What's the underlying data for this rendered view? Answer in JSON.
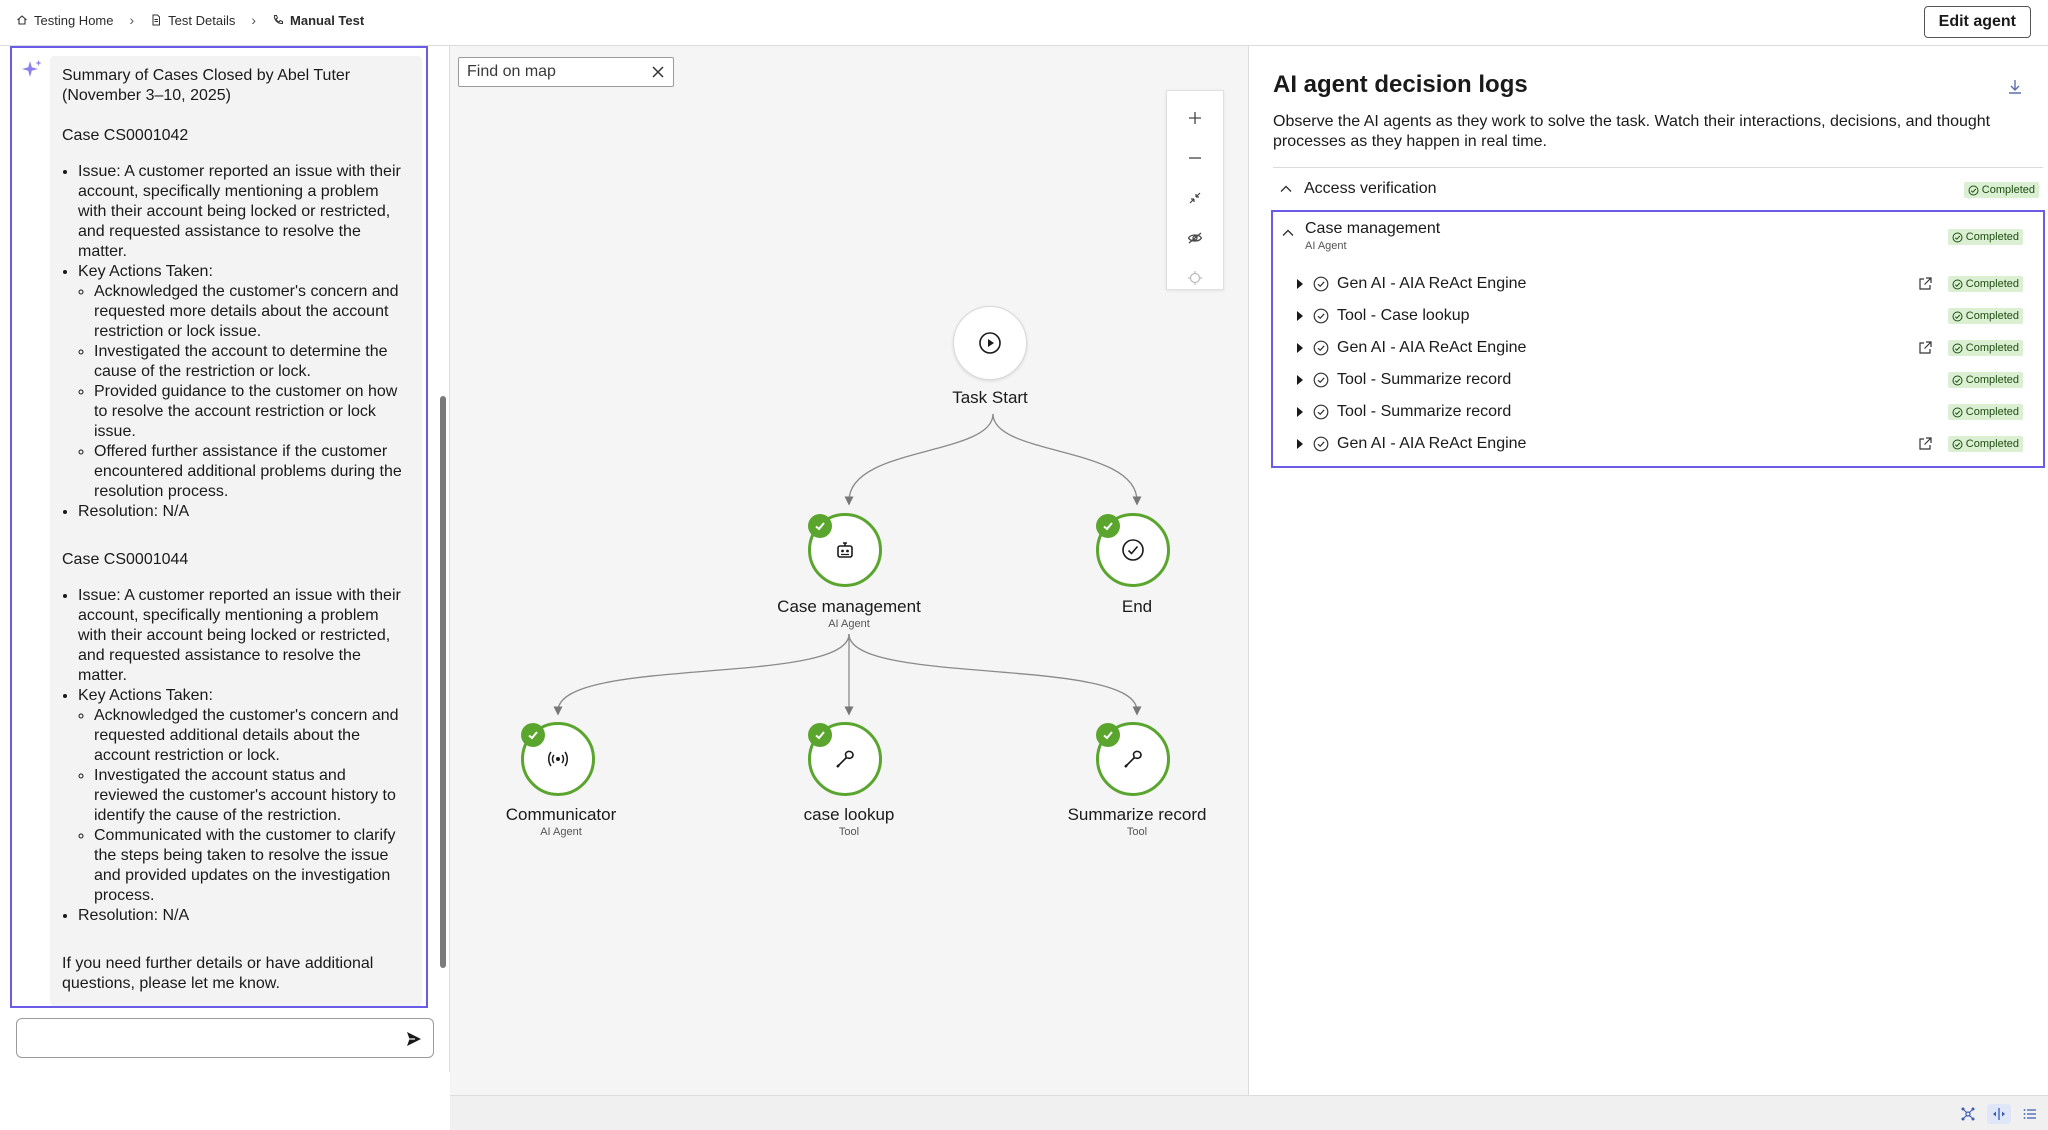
{
  "breadcrumb": {
    "items": [
      {
        "label": "Testing Home",
        "icon": "home-icon"
      },
      {
        "label": "Test Details",
        "icon": "document-icon"
      },
      {
        "label": "Manual Test",
        "icon": "phone-icon"
      }
    ]
  },
  "header": {
    "edit_button": "Edit agent"
  },
  "chat": {
    "title": "Summary of Cases Closed by Abel Tuter (November 3–10, 2025)",
    "cases": [
      {
        "heading": "Case CS0001042",
        "issue": "Issue: A customer reported an issue with their account, specifically mentioning a problem with their account being locked or restricted, and requested assistance to resolve the matter.",
        "actions_label": "Key Actions Taken:",
        "actions": [
          "Acknowledged the customer's concern and requested more details about the account restriction or lock issue.",
          "Investigated the account to determine the cause of the restriction or lock.",
          "Provided guidance to the customer on how to resolve the account restriction or lock issue.",
          "Offered further assistance if the customer encountered additional problems during the resolution process."
        ],
        "resolution": "Resolution: N/A"
      },
      {
        "heading": "Case CS0001044",
        "issue": "Issue: A customer reported an issue with their account, specifically mentioning a problem with their account being locked or restricted, and requested assistance to resolve the matter.",
        "actions_label": "Key Actions Taken:",
        "actions": [
          "Acknowledged the customer's concern and requested additional details about the account restriction or lock.",
          "Investigated the account status and reviewed the customer's account history to identify the cause of the restriction.",
          "Communicated with the customer to clarify the steps being taken to resolve the issue and provided updates on the investigation process."
        ],
        "resolution": "Resolution: N/A"
      }
    ],
    "closing": "If you need further details or have additional questions, please let me know.",
    "input_value": ""
  },
  "canvas": {
    "find_placeholder": "Find on map",
    "nodes": {
      "start": {
        "label": "Task Start"
      },
      "case_mgmt": {
        "label": "Case management",
        "sub": "AI Agent"
      },
      "end": {
        "label": "End"
      },
      "communicator": {
        "label": "Communicator",
        "sub": "AI Agent"
      },
      "case_lookup": {
        "label": "case lookup",
        "sub": "Tool"
      },
      "summarize": {
        "label": "Summarize record",
        "sub": "Tool"
      }
    }
  },
  "logs": {
    "title": "AI agent decision logs",
    "description": "Observe the AI agents as they work to solve the task. Watch their interactions, decisions, and thought processes as they happen in real time.",
    "sections": [
      {
        "name": "Access verification",
        "status": "Completed"
      },
      {
        "name": "Case management",
        "sub": "AI Agent",
        "status": "Completed"
      }
    ],
    "entries": [
      {
        "name": "Gen AI - AIA ReAct Engine",
        "status": "Completed",
        "external": true
      },
      {
        "name": "Tool - Case lookup",
        "status": "Completed",
        "external": false
      },
      {
        "name": "Gen AI - AIA ReAct Engine",
        "status": "Completed",
        "external": true
      },
      {
        "name": "Tool - Summarize record",
        "status": "Completed",
        "external": false
      },
      {
        "name": "Tool - Summarize record",
        "status": "Completed",
        "external": false
      },
      {
        "name": "Gen AI - AIA ReAct Engine",
        "status": "Completed",
        "external": true
      }
    ]
  },
  "colors": {
    "accent": "#6a5ce6",
    "success": "#5aa52e",
    "badge_bg": "#dbf0d2"
  }
}
